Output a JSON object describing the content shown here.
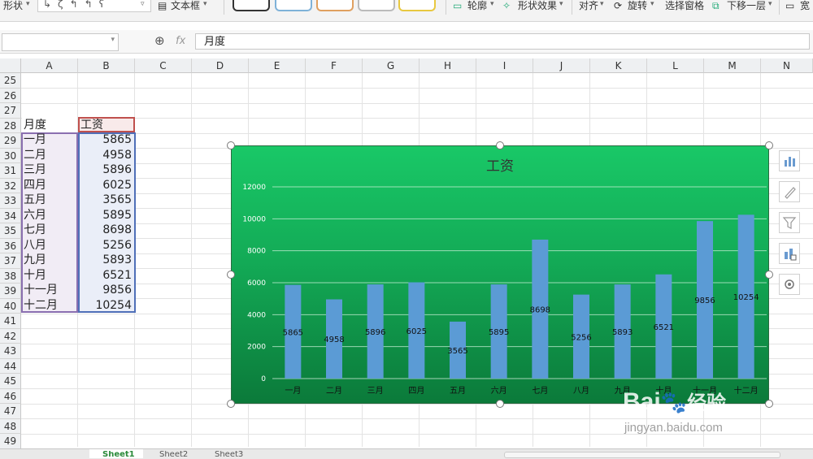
{
  "ribbon": {
    "items": [
      "形状",
      "文本框",
      "轮廓",
      "形状效果",
      "对齐",
      "旋转",
      "选择窗格",
      "下移一层",
      "宽"
    ]
  },
  "formula_bar": {
    "name_box": "",
    "fx_label": "fx",
    "value": "月度"
  },
  "columns": [
    "A",
    "B",
    "C",
    "D",
    "E",
    "F",
    "G",
    "H",
    "I",
    "J",
    "K",
    "L",
    "M",
    "N"
  ],
  "rows": [
    "25",
    "26",
    "27",
    "28",
    "29",
    "30",
    "31",
    "32",
    "33",
    "34",
    "35",
    "36",
    "37",
    "38",
    "39",
    "40",
    "41",
    "42",
    "43",
    "44",
    "45",
    "46",
    "47",
    "48",
    "49"
  ],
  "table": {
    "header": [
      "月度",
      "工资"
    ],
    "rows": [
      [
        "一月",
        "5865"
      ],
      [
        "二月",
        "4958"
      ],
      [
        "三月",
        "5896"
      ],
      [
        "四月",
        "6025"
      ],
      [
        "五月",
        "3565"
      ],
      [
        "六月",
        "5895"
      ],
      [
        "七月",
        "8698"
      ],
      [
        "八月",
        "5256"
      ],
      [
        "九月",
        "5893"
      ],
      [
        "十月",
        "6521"
      ],
      [
        "十一月",
        "9856"
      ],
      [
        "十二月",
        "10254"
      ]
    ]
  },
  "chart_data": {
    "type": "bar",
    "title": "工资",
    "categories": [
      "一月",
      "二月",
      "三月",
      "四月",
      "五月",
      "六月",
      "七月",
      "八月",
      "九月",
      "十月",
      "十一月",
      "十二月"
    ],
    "values": [
      5865,
      4958,
      5896,
      6025,
      3565,
      5895,
      8698,
      5256,
      5893,
      6521,
      9856,
      10254
    ],
    "ylim": [
      0,
      12000
    ],
    "yticks": [
      "0",
      "2000",
      "4000",
      "6000",
      "8000",
      "10000",
      "12000"
    ],
    "grid": true,
    "colors": {
      "bar": "#5b9bd5",
      "background": "#14b85f",
      "gridline": "#c9efd6"
    }
  },
  "side_tools": [
    "chart-elements-icon",
    "chart-style-icon",
    "chart-filter-icon",
    "chart-type-icon",
    "chart-settings-icon"
  ],
  "sheet_tabs": [
    "Sheet1",
    "Sheet2",
    "Sheet3"
  ],
  "watermark": {
    "brand": "Bai",
    "brand2": "经验",
    "url": "jingyan.baidu.com"
  }
}
